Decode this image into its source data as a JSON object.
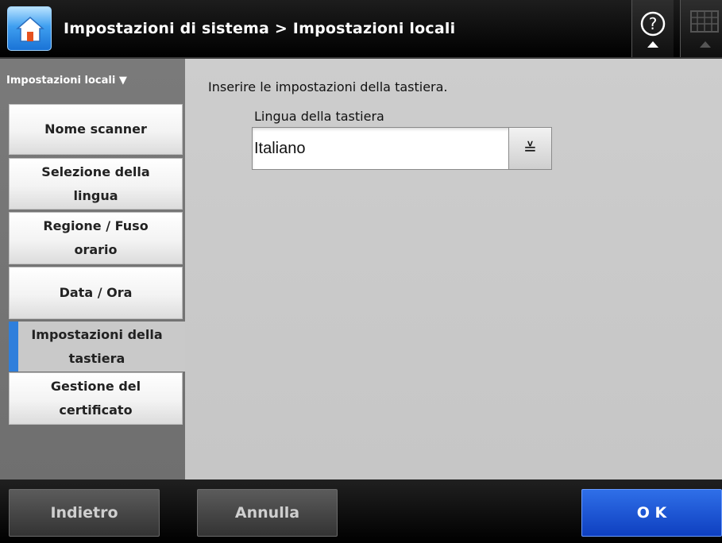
{
  "header": {
    "title": "Impostazioni di sistema > Impostazioni locali",
    "home_icon": "home-icon",
    "help_icon": "help-icon",
    "keyboard_icon": "keyboard-icon"
  },
  "sidebar": {
    "section_label": "Impostazioni locali ▼",
    "items": [
      {
        "label": "Nome scanner"
      },
      {
        "label": "Selezione della lingua"
      },
      {
        "label": "Regione / Fuso orario"
      },
      {
        "label": "Data / Ora"
      },
      {
        "label": "Impostazioni della tastiera",
        "active": true
      },
      {
        "label": "Gestione del certificato"
      }
    ]
  },
  "main": {
    "instruction": "Inserire le impostazioni della tastiera.",
    "field_label": "Lingua della tastiera",
    "selected_value": "Italiano",
    "dropdown_glyph": "≚"
  },
  "footer": {
    "back_label": "Indietro",
    "cancel_label": "Annulla",
    "ok_label": "O K"
  },
  "colors": {
    "accent": "#2f7fdc",
    "ok_button": "#1a55d8",
    "header_bg": "#000000",
    "sidebar_bg": "#777777",
    "main_bg": "#c9c9c9"
  }
}
